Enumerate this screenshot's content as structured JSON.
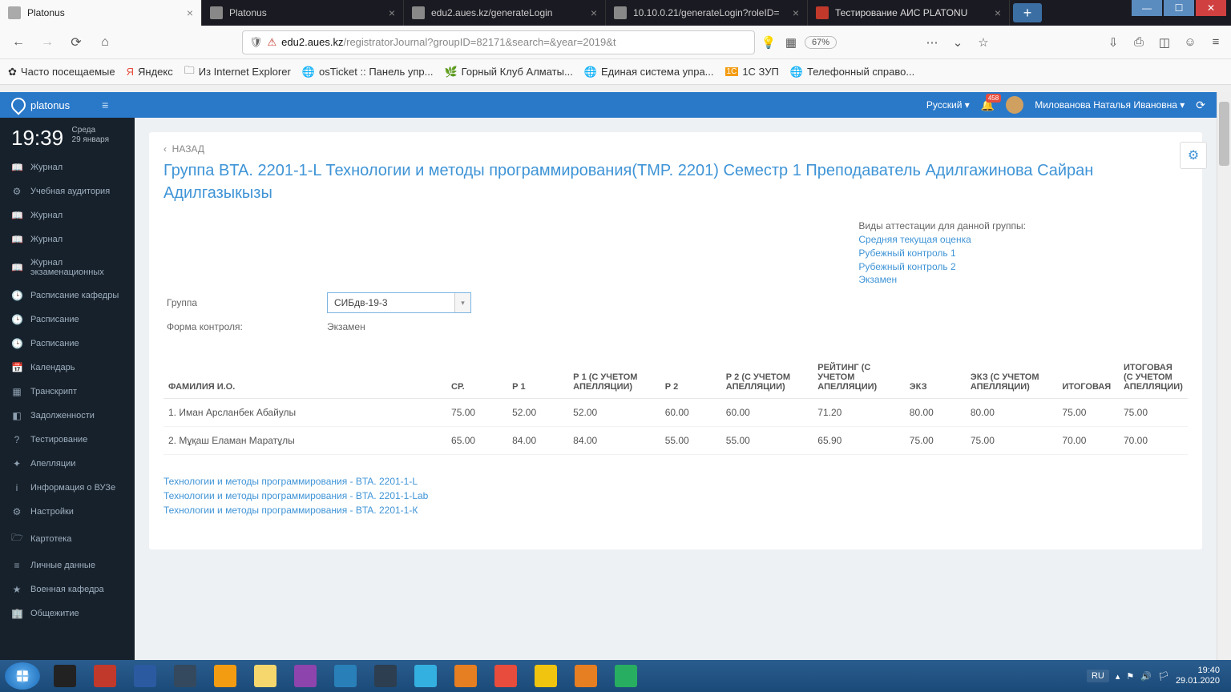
{
  "browser": {
    "tabs": [
      {
        "label": "Platonus",
        "active": true
      },
      {
        "label": "Platonus",
        "active": false
      },
      {
        "label": "edu2.aues.kz/generateLogin",
        "active": false
      },
      {
        "label": "10.10.0.21/generateLogin?roleID=",
        "active": false
      },
      {
        "label": "Тестирование АИС PLATONU",
        "active": false
      }
    ],
    "url_host": "edu2.aues.kz",
    "url_path": "/registratorJournal?groupID=82171&search=&year=2019&t",
    "zoom": "67%"
  },
  "bookmarks": [
    "Часто посещаемые",
    "Яндекс",
    "Из Internet Explorer",
    "osTicket :: Панель упр...",
    "Горный Клуб Алматы...",
    "Единая система упра...",
    "1С ЗУП",
    "Телефонный справо..."
  ],
  "appbar": {
    "brand": "platonus",
    "lang": "Русский",
    "badge": "458",
    "user": "Милованова Наталья Ивановна"
  },
  "clock": {
    "time": "19:39",
    "day": "Среда",
    "date": "29 января"
  },
  "sidebar": [
    "Журнал",
    "Учебная аудитория",
    "Журнал",
    "Журнал",
    "Журнал экзаменационных",
    "Расписание кафедры",
    "Расписание",
    "Расписание",
    "Календарь",
    "Транскрипт",
    "Задолженности",
    "Тестирование",
    "Апелляции",
    "Информация о ВУЗе",
    "Настройки",
    "Картотека",
    "Личные данные",
    "Военная кафедра",
    "Общежитие"
  ],
  "sidebar_icons": [
    "📖",
    "⚙",
    "📖",
    "📖",
    "📖",
    "🕒",
    "🕒",
    "🕒",
    "📅",
    "▦",
    "◧",
    "?",
    "✦",
    "i",
    "⚙",
    "🗁",
    "≡",
    "★",
    "🏢"
  ],
  "page": {
    "back": "НАЗАД",
    "title": "Группа BTA. 2201-1-L Технологии и методы программирования(TMP. 2201) Семестр 1 Преподаватель Адилгажинова Сайран Адилгазыкызы",
    "group_label": "Группа",
    "group_value": "СИБдв-19-3",
    "control_label": "Форма контроля:",
    "control_value": "Экзамен",
    "att_header": "Виды аттестации для данной группы:",
    "att_links": [
      "Средняя текущая оценка",
      "Рубежный контроль 1",
      "Рубежный контроль 2",
      "Экзамен"
    ]
  },
  "table": {
    "headers": [
      "ФАМИЛИЯ И.О.",
      "СР.",
      "Р 1",
      "Р 1 (С УЧЕТОМ АПЕЛЛЯЦИИ)",
      "Р 2",
      "Р 2 (С УЧЕТОМ АПЕЛЛЯЦИИ)",
      "РЕЙТИНГ (С УЧЕТОМ АПЕЛЛЯЦИИ)",
      "ЭКЗ",
      "ЭКЗ (С УЧЕТОМ АПЕЛЛЯЦИИ)",
      "ИТОГОВАЯ",
      "ИТОГОВАЯ (С УЧЕТОМ АПЕЛЛЯЦИИ)"
    ],
    "rows": [
      {
        "name": "1. Иман Арсланбек Абайулы",
        "sr": "75.00",
        "r1": "52.00",
        "r1a": "52.00",
        "r2": "60.00",
        "r2a": "60.00",
        "rating": "71.20",
        "ekz": "80.00",
        "ekza": "80.00",
        "fin": "75.00",
        "fina": "75.00"
      },
      {
        "name": "2. Мұқаш Еламан Маратұлы",
        "sr": "65.00",
        "r1": "84.00",
        "r1a": "84.00",
        "r2": "55.00",
        "r2a": "55.00",
        "rating": "65.90",
        "ekz": "75.00",
        "ekza": "75.00",
        "fin": "70.00",
        "fina": "70.00"
      }
    ]
  },
  "bottom_links": [
    "Технологии и методы программирования - BTA. 2201-1-L",
    "Технологии и методы программирования - BTA. 2201-1-Lab",
    "Технологии и методы программирования - BTA. 2201-1-К"
  ],
  "taskbar": {
    "lang": "RU",
    "time": "19:40",
    "date": "29.01.2020",
    "apps": [
      "#222",
      "#c0392b",
      "#2c5aa0",
      "#34495e",
      "#f39c12",
      "#f5d76e",
      "#8e44ad",
      "#2980b9",
      "#2c3e50",
      "#34b0e0",
      "#e67e22",
      "#e74c3c",
      "#f1c40f",
      "#e67e22",
      "#27ae60"
    ]
  }
}
